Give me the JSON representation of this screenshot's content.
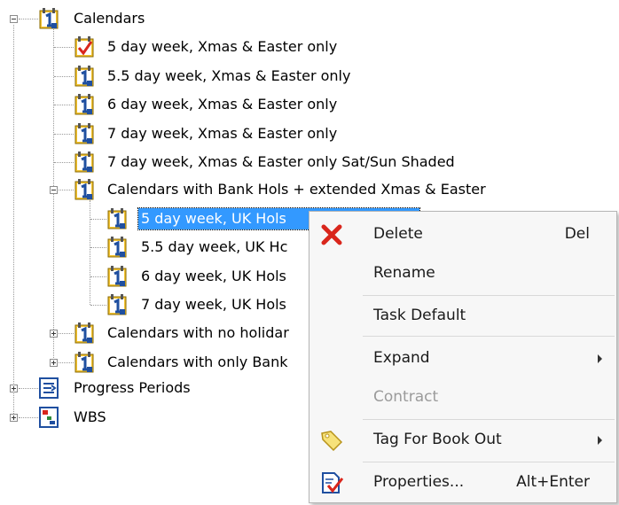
{
  "tree": {
    "root": {
      "label": "Calendars",
      "icon": "calendar-icon"
    },
    "items": [
      {
        "label": "5 day week, Xmas & Easter only",
        "icon": "calendar-check-icon"
      },
      {
        "label": "5.5 day week, Xmas & Easter only",
        "icon": "calendar-icon"
      },
      {
        "label": "6 day week, Xmas & Easter only",
        "icon": "calendar-icon"
      },
      {
        "label": "7 day week, Xmas & Easter only",
        "icon": "calendar-icon"
      },
      {
        "label": "7 day week, Xmas & Easter only Sat/Sun Shaded",
        "icon": "calendar-icon"
      }
    ],
    "group_bank": {
      "label": "Calendars with Bank Hols + extended Xmas & Easter",
      "children": [
        {
          "label": "5 day week, UK Hols",
          "selected": true
        },
        {
          "label": "5.5 day week, UK Hc"
        },
        {
          "label": "6 day week, UK Hols"
        },
        {
          "label": "7 day week, UK Hols"
        }
      ]
    },
    "group_no_holidays": {
      "label": "Calendars with no holidar"
    },
    "group_only_bank": {
      "label": "Calendars with only Bank"
    },
    "progress_periods": {
      "label": "Progress Periods",
      "icon": "progress-periods-icon"
    },
    "wbs": {
      "label": "WBS",
      "icon": "wbs-icon"
    }
  },
  "context_menu": {
    "delete": {
      "label": "Delete",
      "shortcut": "Del",
      "icon": "red-x-icon"
    },
    "rename": {
      "label": "Rename"
    },
    "task_default": {
      "label": "Task Default"
    },
    "expand": {
      "label": "Expand"
    },
    "contract": {
      "label": "Contract",
      "disabled": true
    },
    "tag_for_book_out": {
      "label": "Tag For Book Out",
      "icon": "tag-icon"
    },
    "properties": {
      "label": "Properties...",
      "shortcut": "Alt+Enter",
      "icon": "properties-icon"
    }
  },
  "colors": {
    "selection": "#3399ff",
    "calendar_blue": "#1f4fa0",
    "calendar_yellow": "#f2c230",
    "delete_red": "#d9261c"
  }
}
